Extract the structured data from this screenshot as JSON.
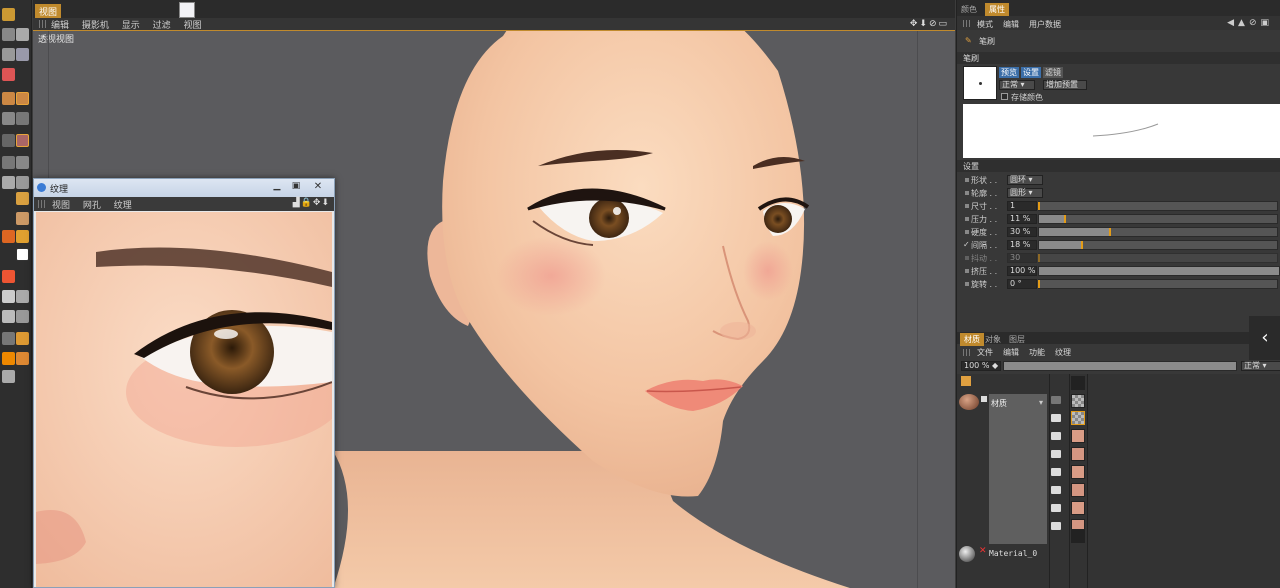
{
  "viewport": {
    "tab": "视图",
    "menu": [
      "编辑",
      "摄影机",
      "显示",
      "过滤",
      "视图"
    ],
    "label": "透视视图"
  },
  "texture_window": {
    "title": "纹理",
    "menu": [
      "视图",
      "网孔",
      "纹理"
    ]
  },
  "attributes": {
    "tabs": [
      "颜色",
      "属性"
    ],
    "menu": [
      "模式",
      "编辑",
      "用户数据"
    ],
    "tool_name": "笔刷",
    "section_brush": "笔刷",
    "preset_tabs": [
      "预览",
      "设置",
      "滤镜"
    ],
    "mode_select": "正常",
    "add_preset_button": "增加预置",
    "store_color_label": "存储颜色",
    "section_settings": "设置",
    "settings": [
      {
        "label": "形状",
        "type": "select",
        "value": "圆环"
      },
      {
        "label": "轮廓",
        "type": "select",
        "value": "圆形"
      },
      {
        "label": "尺寸",
        "type": "slider",
        "value": "1",
        "level": 0.0
      },
      {
        "label": "压力",
        "type": "slider",
        "value": "11 %",
        "level": 0.11
      },
      {
        "label": "硬度",
        "type": "slider",
        "value": "30 %",
        "level": 0.3
      },
      {
        "label": "间隔",
        "type": "slider",
        "value": "18 %",
        "level": 0.18,
        "checked": true
      },
      {
        "label": "抖动",
        "type": "slider",
        "value": "30",
        "level": 0.0,
        "disabled": true
      },
      {
        "label": "挤压",
        "type": "slider",
        "value": "100 %",
        "level": 1.0
      },
      {
        "label": "旋转",
        "type": "slider",
        "value": "0 °",
        "level": 0.0
      }
    ]
  },
  "materials": {
    "tabs": [
      "材质",
      "对象",
      "图层"
    ],
    "menu": [
      "文件",
      "编辑",
      "功能",
      "纹理"
    ],
    "zoom": "100 %",
    "blend_mode": "正常",
    "items": [
      {
        "name": "材质"
      },
      {
        "name": "Material_0"
      }
    ]
  },
  "colors": {
    "accent": "#c08a2d",
    "slider_knob": "#e39c18"
  }
}
